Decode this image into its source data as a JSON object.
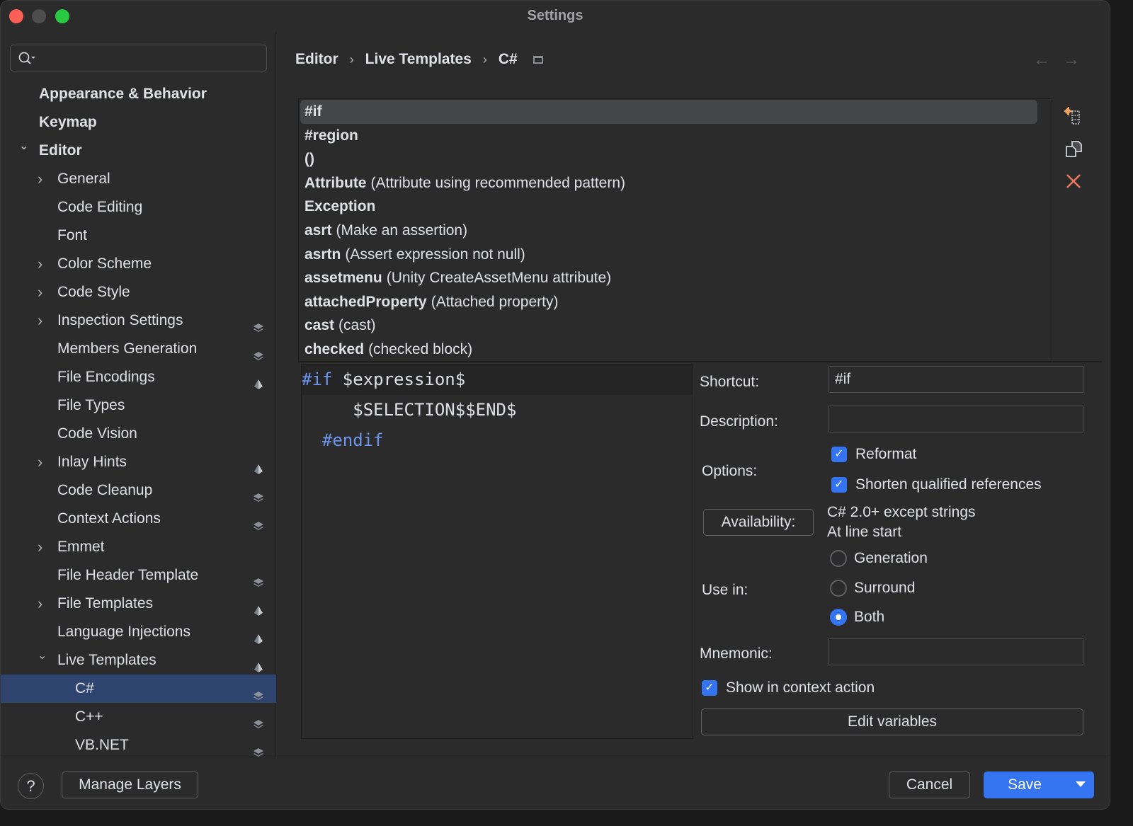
{
  "window": {
    "title": "Settings"
  },
  "search": {
    "placeholder": "",
    "value": ""
  },
  "sidebar": {
    "items": [
      {
        "label": "Appearance & Behavior",
        "level": 0,
        "bold": true,
        "chevron": "none",
        "layer_icon": "none"
      },
      {
        "label": "Keymap",
        "level": 0,
        "bold": true,
        "chevron": "none",
        "layer_icon": "none"
      },
      {
        "label": "Editor",
        "level": 0,
        "bold": true,
        "chevron": "expanded",
        "layer_icon": "none"
      },
      {
        "label": "General",
        "level": 1,
        "chevron": "collapsed",
        "layer_icon": "none"
      },
      {
        "label": "Code Editing",
        "level": 1,
        "chevron": "none",
        "layer_icon": "none"
      },
      {
        "label": "Font",
        "level": 1,
        "chevron": "none",
        "layer_icon": "none"
      },
      {
        "label": "Color Scheme",
        "level": 1,
        "chevron": "collapsed",
        "layer_icon": "none"
      },
      {
        "label": "Code Style",
        "level": 1,
        "chevron": "collapsed",
        "layer_icon": "none"
      },
      {
        "label": "Inspection Settings",
        "level": 1,
        "chevron": "collapsed",
        "layer_icon": "layers-icon"
      },
      {
        "label": "Members Generation",
        "level": 1,
        "chevron": "none",
        "layer_icon": "layers-icon"
      },
      {
        "label": "File Encodings",
        "level": 1,
        "chevron": "none",
        "layer_icon": "project-icon"
      },
      {
        "label": "File Types",
        "level": 1,
        "chevron": "none",
        "layer_icon": "none"
      },
      {
        "label": "Code Vision",
        "level": 1,
        "chevron": "none",
        "layer_icon": "none"
      },
      {
        "label": "Inlay Hints",
        "level": 1,
        "chevron": "collapsed",
        "layer_icon": "project-icon"
      },
      {
        "label": "Code Cleanup",
        "level": 1,
        "chevron": "none",
        "layer_icon": "layers-icon"
      },
      {
        "label": "Context Actions",
        "level": 1,
        "chevron": "none",
        "layer_icon": "layers-icon"
      },
      {
        "label": "Emmet",
        "level": 1,
        "chevron": "collapsed",
        "layer_icon": "none"
      },
      {
        "label": "File Header Template",
        "level": 1,
        "chevron": "none",
        "layer_icon": "layers-icon"
      },
      {
        "label": "File Templates",
        "level": 1,
        "chevron": "collapsed",
        "layer_icon": "project-icon"
      },
      {
        "label": "Language Injections",
        "level": 1,
        "chevron": "none",
        "layer_icon": "project-icon"
      },
      {
        "label": "Live Templates",
        "level": 1,
        "chevron": "expanded",
        "layer_icon": "project-icon"
      },
      {
        "label": "C#",
        "level": 2,
        "chevron": "none",
        "layer_icon": "layers-icon",
        "selected": true
      },
      {
        "label": "C++",
        "level": 2,
        "chevron": "none",
        "layer_icon": "layers-icon"
      },
      {
        "label": "VB.NET",
        "level": 2,
        "chevron": "none",
        "layer_icon": "layers-icon"
      }
    ]
  },
  "breadcrumb": {
    "items": [
      "Editor",
      "Live Templates",
      "C#"
    ],
    "separator": "›"
  },
  "nav": {
    "back": "←",
    "forward": "→"
  },
  "templates": {
    "items": [
      {
        "abbr": "#if",
        "desc": "",
        "selected": true
      },
      {
        "abbr": "#region",
        "desc": ""
      },
      {
        "abbr": "()",
        "desc": ""
      },
      {
        "abbr": "Attribute",
        "desc": "(Attribute using recommended pattern)"
      },
      {
        "abbr": "Exception",
        "desc": ""
      },
      {
        "abbr": "asrt",
        "desc": "(Make an assertion)"
      },
      {
        "abbr": "asrtn",
        "desc": "(Assert expression not null)"
      },
      {
        "abbr": "assetmenu",
        "desc": "(Unity CreateAssetMenu attribute)"
      },
      {
        "abbr": "attachedProperty",
        "desc": "(Attached property)"
      },
      {
        "abbr": "cast",
        "desc": "(cast)"
      },
      {
        "abbr": "checked",
        "desc": "(checked block)"
      }
    ]
  },
  "editor": {
    "lines": [
      {
        "kw": "#if",
        "rest": " $expression$",
        "indent": ""
      },
      {
        "kw": "",
        "rest": "$SELECTION$$END$",
        "indent": "     "
      },
      {
        "kw": "#endif",
        "rest": "",
        "indent": "  "
      }
    ]
  },
  "props": {
    "shortcut_label": "Shortcut:",
    "shortcut_value": "#if",
    "description_label": "Description:",
    "description_value": "",
    "options_label": "Options:",
    "reformat_label": "Reformat",
    "reformat_checked": true,
    "shorten_label": "Shorten qualified references",
    "shorten_checked": true,
    "availability_button": "Availability:",
    "availability_line1": "C# 2.0+ except strings",
    "availability_line2": "At line start",
    "use_in_label": "Use in:",
    "use_in_options": [
      "Generation",
      "Surround",
      "Both"
    ],
    "use_in_selected": "Both",
    "mnemonic_label": "Mnemonic:",
    "mnemonic_value": "",
    "show_context_label": "Show in context action",
    "show_context_checked": true,
    "edit_variables": "Edit variables"
  },
  "footer": {
    "help": "?",
    "manage_layers": "Manage Layers",
    "cancel": "Cancel",
    "save": "Save"
  },
  "colors": {
    "accent": "#3574f0",
    "selection": "#2e436e",
    "keyword": "#6c95eb",
    "delete": "#e8765f"
  }
}
